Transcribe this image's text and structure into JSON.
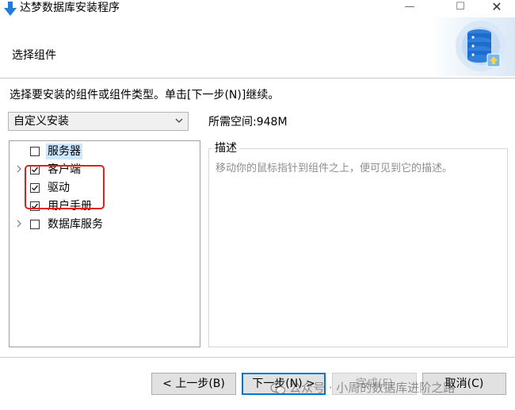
{
  "window": {
    "title": "达梦数据库安装程序",
    "minimize_glyph": "—",
    "maximize_glyph": "☐",
    "close_glyph": "✕"
  },
  "header": {
    "title": "选择组件",
    "graphic_icon": "database-icon"
  },
  "instruction": "选择要安装的组件或组件类型。单击[下一步(N)]继续。",
  "install_type": {
    "selected": "自定义安装"
  },
  "space_required": "所需空间:948M",
  "components": [
    {
      "label": "服务器",
      "checked": false,
      "expandable": false,
      "selected": true
    },
    {
      "label": "客户端",
      "checked": true,
      "expandable": true,
      "selected": false
    },
    {
      "label": "驱动",
      "checked": true,
      "expandable": false,
      "selected": false
    },
    {
      "label": "用户手册",
      "checked": true,
      "expandable": false,
      "selected": false
    },
    {
      "label": "数据库服务",
      "checked": false,
      "expandable": true,
      "selected": false
    }
  ],
  "description": {
    "title": "描述",
    "text": "移动你的鼠标指针到组件之上，便可见到它的描述。"
  },
  "buttons": {
    "back": "< 上一步(B)",
    "next": "下一步(N) >",
    "finish": "完成(F)",
    "cancel": "取消(C)"
  },
  "watermark": "公众号 · 小周的数据库进阶之路",
  "colors": {
    "highlight_box": "#e0211b",
    "focus_border": "#0078d7",
    "selection": "#cce8ff"
  }
}
